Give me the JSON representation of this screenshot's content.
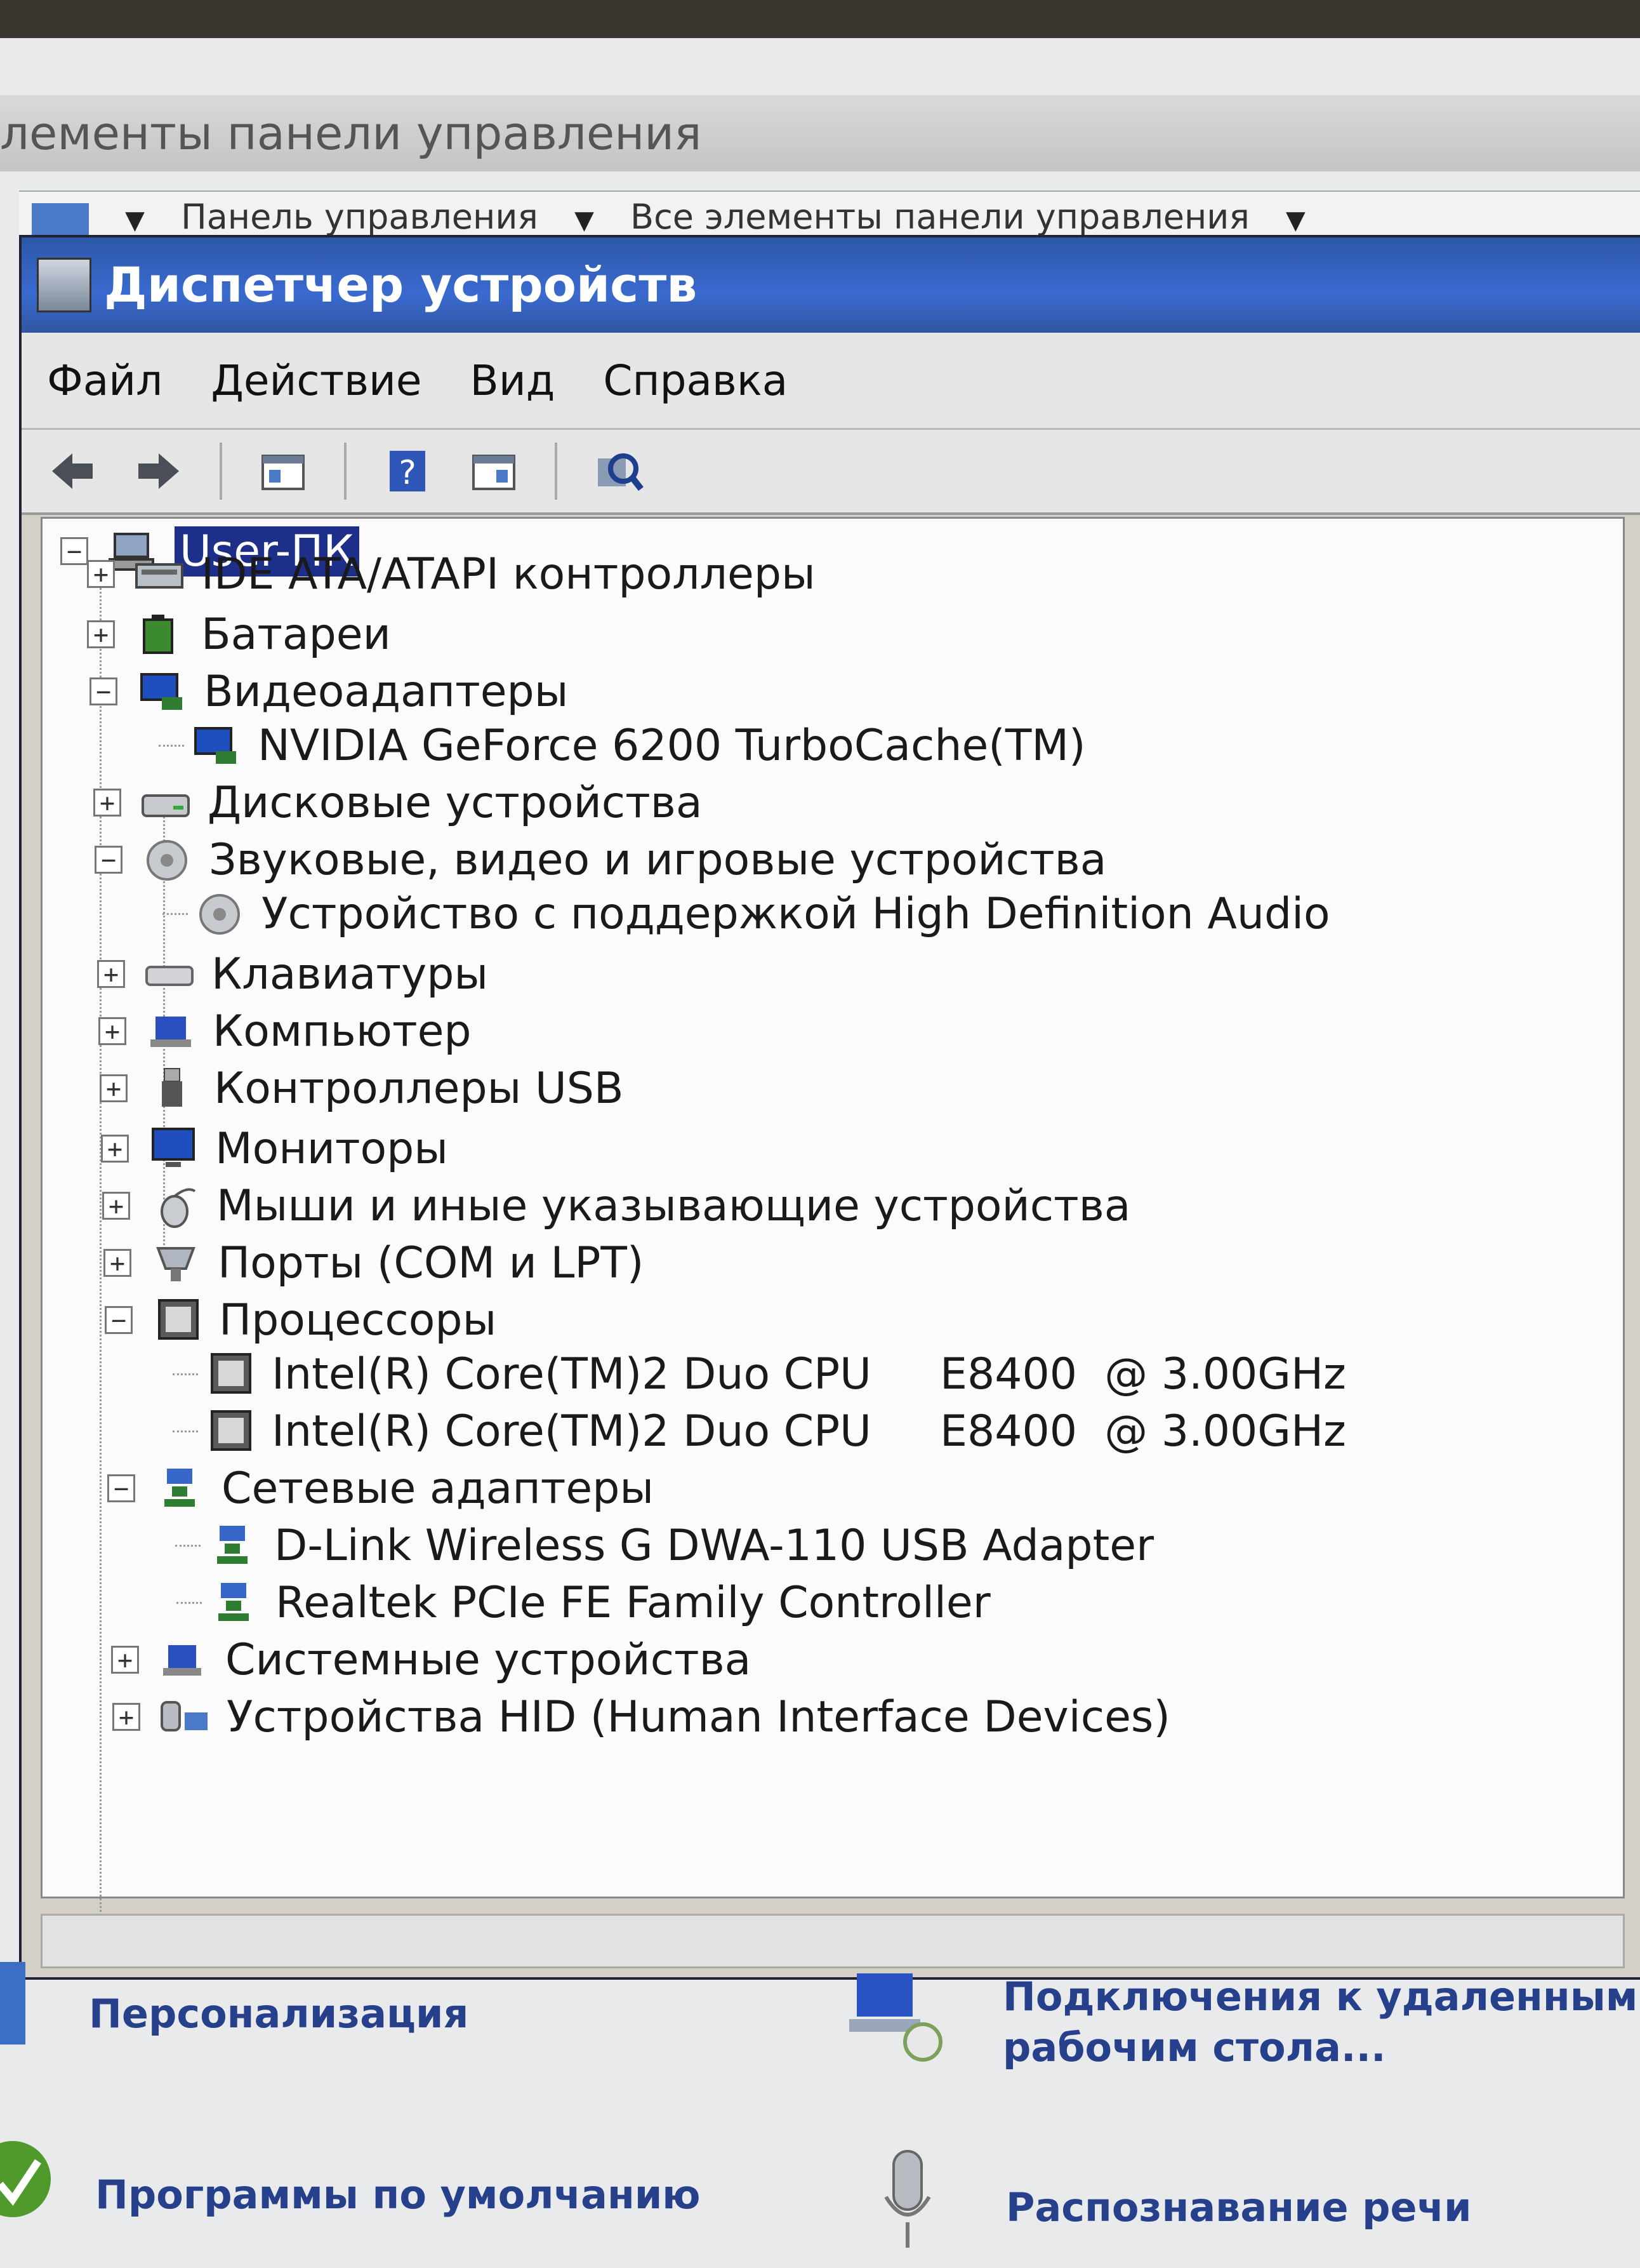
{
  "background_window": {
    "title": "лементы панели управления",
    "address_segments": [
      "Панель управления",
      "Все элементы панели управления"
    ]
  },
  "device_manager": {
    "title": "Диспетчер устройств",
    "menu": [
      "Файл",
      "Действие",
      "Вид",
      "Справка"
    ],
    "toolbar_icons": [
      "back-arrow-icon",
      "forward-arrow-icon",
      "properties-icon",
      "help-icon",
      "view-icon",
      "scan-hardware-icon"
    ],
    "root": "User-ПК",
    "tree": [
      {
        "label": "IDE ATA/ATAPI контроллеры",
        "expander": "+",
        "icon": "ide-controller-icon"
      },
      {
        "label": "Батареи",
        "expander": "+",
        "icon": "battery-icon"
      },
      {
        "label": "Видеоадаптеры",
        "expander": "−",
        "icon": "display-adapter-icon"
      },
      {
        "label": "NVIDIA GeForce 6200 TurboCache(TM)",
        "child": true,
        "icon": "display-adapter-icon"
      },
      {
        "label": "Дисковые устройства",
        "expander": "+",
        "icon": "disk-drive-icon"
      },
      {
        "label": "Звуковые, видео и игровые устройства",
        "expander": "−",
        "icon": "sound-icon"
      },
      {
        "label": "Устройство с поддержкой High Definition Audio",
        "child": true,
        "icon": "sound-icon"
      },
      {
        "label": "Клавиатуры",
        "expander": "+",
        "icon": "keyboard-icon"
      },
      {
        "label": "Компьютер",
        "expander": "+",
        "icon": "computer-icon"
      },
      {
        "label": "Контроллеры USB",
        "expander": "+",
        "icon": "usb-icon"
      },
      {
        "label": "Мониторы",
        "expander": "+",
        "icon": "monitor-icon"
      },
      {
        "label": "Мыши и иные указывающие устройства",
        "expander": "+",
        "icon": "mouse-icon"
      },
      {
        "label": "Порты (COM и LPT)",
        "expander": "+",
        "icon": "port-icon"
      },
      {
        "label": "Процессоры",
        "expander": "−",
        "icon": "processor-icon"
      },
      {
        "label": "Intel(R) Core(TM)2 Duo CPU     E8400  @ 3.00GHz",
        "child": true,
        "icon": "processor-icon"
      },
      {
        "label": "Intel(R) Core(TM)2 Duo CPU     E8400  @ 3.00GHz",
        "child": true,
        "icon": "processor-icon"
      },
      {
        "label": "Сетевые адаптеры",
        "expander": "−",
        "icon": "network-adapter-icon"
      },
      {
        "label": "D-Link Wireless G DWA-110 USB Adapter",
        "child": true,
        "icon": "network-adapter-icon"
      },
      {
        "label": "Realtek PCIe FE Family Controller",
        "child": true,
        "icon": "network-adapter-icon"
      },
      {
        "label": "Системные устройства",
        "expander": "+",
        "icon": "system-devices-icon"
      },
      {
        "label": "Устройства HID (Human Interface Devices)",
        "expander": "+",
        "icon": "hid-icon"
      }
    ]
  },
  "control_panel_items": {
    "personalization": "Персонализация",
    "remote_connections_line1": "Подключения к удаленным",
    "remote_connections_line2": "рабочим стола...",
    "default_programs": "Программы по умолчанию",
    "speech_recognition": "Распознавание речи"
  },
  "colors": {
    "title_bar": "#2d58a8",
    "selection": "#1e2f8a",
    "link": "#27408b"
  }
}
